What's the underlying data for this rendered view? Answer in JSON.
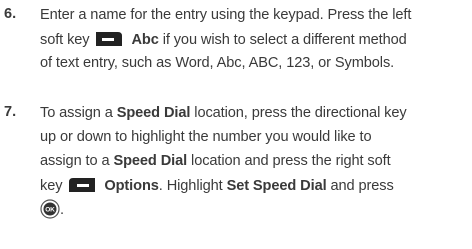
{
  "step6": {
    "number": "6.",
    "line1": "Enter a name for the entry using the keypad. Press the left",
    "line2_before": "soft key",
    "line2_key_label": "Abc",
    "line2_after": "if you wish to select a different method",
    "line3": "of text entry, such as Word, Abc, ABC, 123, or Symbols."
  },
  "step7": {
    "number": "7.",
    "line1_before": "To assign a",
    "line1_bold": "Speed Dial",
    "line1_after": "location, press the directional key",
    "line2": "up or down to highlight the number you would like to",
    "line3_before": "assign to a",
    "line3_bold": "Speed Dial",
    "line3_after": "location and press the right soft",
    "line4_before": "key",
    "line4_key_label": "Options",
    "line4_middle": ". Highlight",
    "line4_bold": "Set Speed Dial",
    "line4_after": "and press",
    "line5_key_label": "OK",
    "line5_after": "."
  },
  "icons": {
    "left_soft_key": "left-soft-key-icon",
    "right_soft_key": "right-soft-key-icon",
    "ok_key": "ok-key-icon"
  },
  "colors": {
    "text": "#3a3a3a",
    "key_fill": "#222222"
  }
}
